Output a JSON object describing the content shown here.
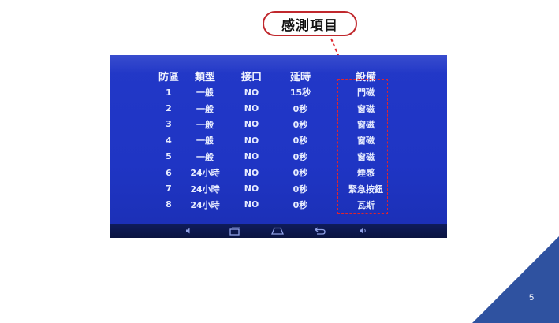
{
  "callout": {
    "label": "感測項目"
  },
  "table": {
    "headers": [
      "防區",
      "類型",
      "接口",
      "延時",
      "設備"
    ],
    "rows": [
      [
        "1",
        "一般",
        "NO",
        "15秒",
        "門磁"
      ],
      [
        "2",
        "一般",
        "NO",
        "0秒",
        "窗磁"
      ],
      [
        "3",
        "一般",
        "NO",
        "0秒",
        "窗磁"
      ],
      [
        "4",
        "一般",
        "NO",
        "0秒",
        "窗磁"
      ],
      [
        "5",
        "一般",
        "NO",
        "0秒",
        "窗磁"
      ],
      [
        "6",
        "24小時",
        "NO",
        "0秒",
        "煙感"
      ],
      [
        "7",
        "24小時",
        "NO",
        "0秒",
        "緊急按鈕"
      ],
      [
        "8",
        "24小時",
        "NO",
        "0秒",
        "瓦斯"
      ]
    ]
  },
  "navbar": {
    "icons": [
      "volume-down-icon",
      "recent-apps-icon",
      "home-icon",
      "back-icon",
      "volume-up-icon"
    ]
  },
  "colors": {
    "screen_blue": "#1f35c4",
    "highlight_red": "#e0242c",
    "corner_blue": "#2f52a0"
  },
  "page": {
    "number": "5"
  }
}
